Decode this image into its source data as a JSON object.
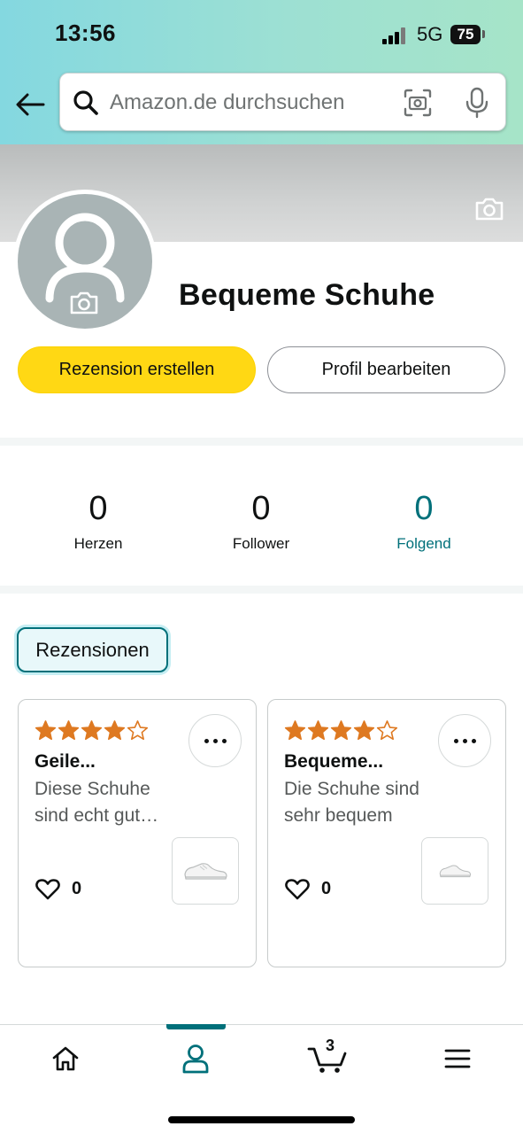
{
  "status_bar": {
    "time": "13:56",
    "network": "5G",
    "battery": "75"
  },
  "search": {
    "placeholder": "Amazon.de durchsuchen"
  },
  "profile": {
    "name": "Bequeme Schuhe",
    "create_review_label": "Rezension erstellen",
    "edit_profile_label": "Profil bearbeiten"
  },
  "stats": [
    {
      "value": "0",
      "label": "Herzen"
    },
    {
      "value": "0",
      "label": "Follower"
    },
    {
      "value": "0",
      "label": "Folgend"
    }
  ],
  "tabs": {
    "reviews_label": "Rezensionen"
  },
  "reviews": [
    {
      "rating": 4,
      "max_rating": 5,
      "title": "Geile...",
      "body": "Diese Schuhe sind echt gut…",
      "hearts": "0"
    },
    {
      "rating": 4,
      "max_rating": 5,
      "title": "Bequeme...",
      "body": "Die Schuhe sind sehr bequem",
      "hearts": "0"
    }
  ],
  "bottom_nav": {
    "items": [
      "home-icon",
      "profile-icon",
      "cart-icon",
      "menu-icon"
    ],
    "active": "profile-icon",
    "cart_count": "3"
  },
  "colors": {
    "accent_teal": "#00707a",
    "primary_button": "#ffd814",
    "star": "#de7921"
  }
}
